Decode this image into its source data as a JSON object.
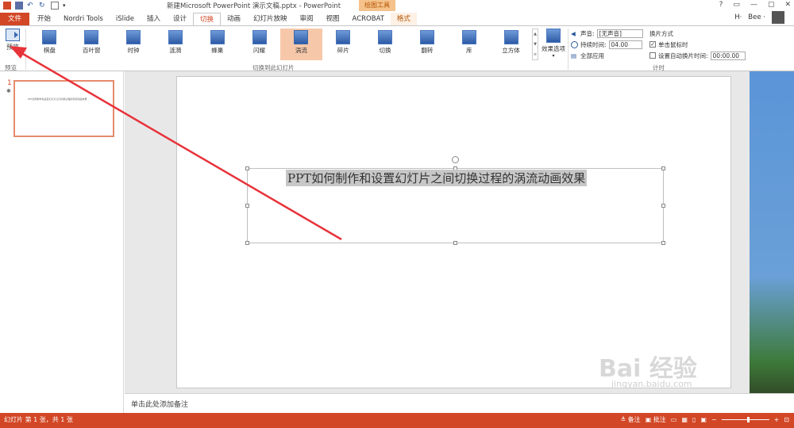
{
  "window": {
    "title": "新建Microsoft PowerPoint 演示文稿.pptx - PowerPoint",
    "contextual_tab_group": "绘图工具",
    "controls": [
      "?",
      "▭",
      "—",
      "▢",
      "✕"
    ]
  },
  "tabs": [
    {
      "label": "文件",
      "kind": "file"
    },
    {
      "label": "开始"
    },
    {
      "label": "Nordri Tools"
    },
    {
      "label": "iSlide"
    },
    {
      "label": "插入"
    },
    {
      "label": "设计"
    },
    {
      "label": "切换",
      "kind": "active"
    },
    {
      "label": "动画"
    },
    {
      "label": "幻灯片放映"
    },
    {
      "label": "审阅"
    },
    {
      "label": "视图"
    },
    {
      "label": "ACROBAT"
    },
    {
      "label": "格式",
      "kind": "format"
    }
  ],
  "user": {
    "initial": "H·",
    "name": "Bee ·"
  },
  "ribbon": {
    "preview": {
      "button": "预览",
      "group": "预览"
    },
    "transitions_group": "切换到此幻灯片",
    "gallery": [
      "棋盘",
      "百叶窗",
      "时钟",
      "涟漪",
      "蜂巢",
      "闪耀",
      "涡流",
      "碎片",
      "切换",
      "翻转",
      "库",
      "立方体"
    ],
    "selected": "涡流",
    "effect_options": "效果选项",
    "timing": {
      "sound_label": "声音:",
      "sound_value": "[无声音]",
      "duration_label": "持续时间:",
      "duration_value": "04.00",
      "apply_all": "全部应用",
      "advance_label": "换片方式",
      "on_click": "单击鼠标时",
      "on_click_checked": true,
      "after_label": "设置自动换片时间:",
      "after_value": "00:00.00",
      "after_checked": false,
      "group": "计时"
    }
  },
  "slides": [
    {
      "number": "1",
      "marker": "✱",
      "title": "PPT如何制作和设置幻灯片之间切换过程的涡流动画效果"
    }
  ],
  "canvas": {
    "title": "PPT如何制作和设置幻灯片之间切换过程的涡流动画效果"
  },
  "notes": {
    "placeholder": "单击此处添加备注"
  },
  "status": {
    "slide_info": "幻灯片 第 1 张，共 1 张",
    "notes_btn": "≜ 备注",
    "comments_btn": "▣ 批注"
  },
  "watermark": {
    "brand": "Bai 经验",
    "url": "jingyan.baidu.com"
  },
  "colors": {
    "accent": "#d24726",
    "selected_gallery": "#f6c8a9",
    "annotation_arrow": "#e8333a"
  }
}
